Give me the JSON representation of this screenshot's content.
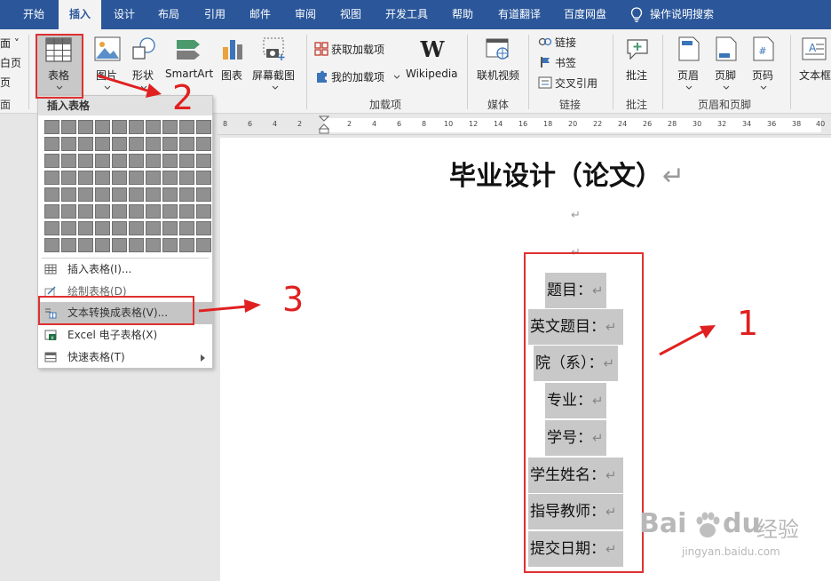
{
  "tabs": [
    "开始",
    "插入",
    "设计",
    "布局",
    "引用",
    "邮件",
    "审阅",
    "视图",
    "开发工具",
    "帮助",
    "有道翻译",
    "百度网盘",
    "操作说明搜索"
  ],
  "active_tab": "插入",
  "ribbon": {
    "left_stubs": [
      "面",
      "白页",
      "页",
      "面"
    ],
    "table_btn": "表格",
    "picture_btn": "图片",
    "shapes_btn": "形状",
    "smartart_btn": "SmartArt",
    "chart_btn": "图表",
    "screenshot_btn": "屏幕截图",
    "get_addins": "获取加载项",
    "my_addins": "我的加载项",
    "wikipedia": "Wikipedia",
    "addins_group": "加载项",
    "online_video": "联机视频",
    "media_group": "媒体",
    "link": "链接",
    "bookmark": "书签",
    "cross_ref": "交叉引用",
    "links_group": "链接",
    "comment": "批注",
    "comment_group": "批注",
    "header": "页眉",
    "footer": "页脚",
    "page_number": "页码",
    "header_footer_group": "页眉和页脚",
    "textbox": "文本框"
  },
  "dropdown": {
    "header": "插入表格",
    "items": [
      {
        "label": "插入表格(I)..."
      },
      {
        "label": "绘制表格(D)"
      },
      {
        "label": "文本转换成表格(V)..."
      },
      {
        "label": "Excel 电子表格(X)"
      },
      {
        "label": "快速表格(T)"
      }
    ]
  },
  "ruler_ticks": [
    "8",
    "6",
    "4",
    "2",
    "2",
    "2",
    "4",
    "6",
    "8",
    "10",
    "12",
    "14",
    "16",
    "18",
    "20",
    "22",
    "24",
    "26",
    "28",
    "30",
    "32",
    "34",
    "36",
    "38",
    "40"
  ],
  "document": {
    "title": "毕业设计（论文）",
    "para_mark": "↵",
    "fields": [
      "题目：",
      "英文题目：",
      "院（系）：",
      "专业：",
      "学号：",
      "学生姓名：",
      "指导教师：",
      "提交日期："
    ]
  },
  "annotations": [
    "1",
    "2",
    "3"
  ],
  "watermark": {
    "brand": "Bai",
    "brand2": "du",
    "cn": "经验",
    "url": "jingyan.baidu.com"
  },
  "colors": {
    "accent": "#2b579a",
    "annotation": "#e02020",
    "highlight": "#c8c8c8"
  }
}
